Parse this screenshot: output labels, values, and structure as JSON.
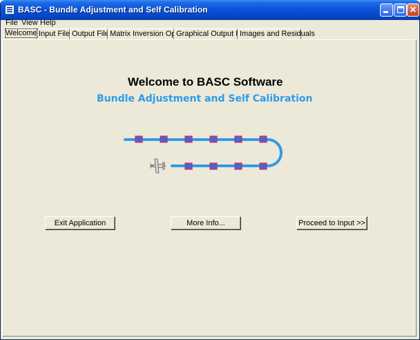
{
  "window": {
    "title": "BASC - Bundle Adjustment and Self Calibration"
  },
  "menu": [
    "File",
    "View",
    "Help"
  ],
  "tabs": [
    "Welcome",
    "Input Files",
    "Output Files",
    "Matrix Inversion Option",
    "Graphical Output Files",
    "Images and Residuals"
  ],
  "welcome": {
    "heading": "Welcome to BASC Software",
    "subheading": "Bundle Adjustment and Self Calibration"
  },
  "buttons": {
    "exit": "Exit Application",
    "more": "More Info...",
    "proceed": "Proceed to Input >>"
  },
  "colors": {
    "accent": "#2E9BEB",
    "title_bar": "#0B54D9",
    "face": "#ECE9D8",
    "marker_fill": "#4A63D8",
    "marker_border": "#D0304A"
  },
  "icons": {
    "app": "grid-icon",
    "plane": "airplane-icon"
  }
}
